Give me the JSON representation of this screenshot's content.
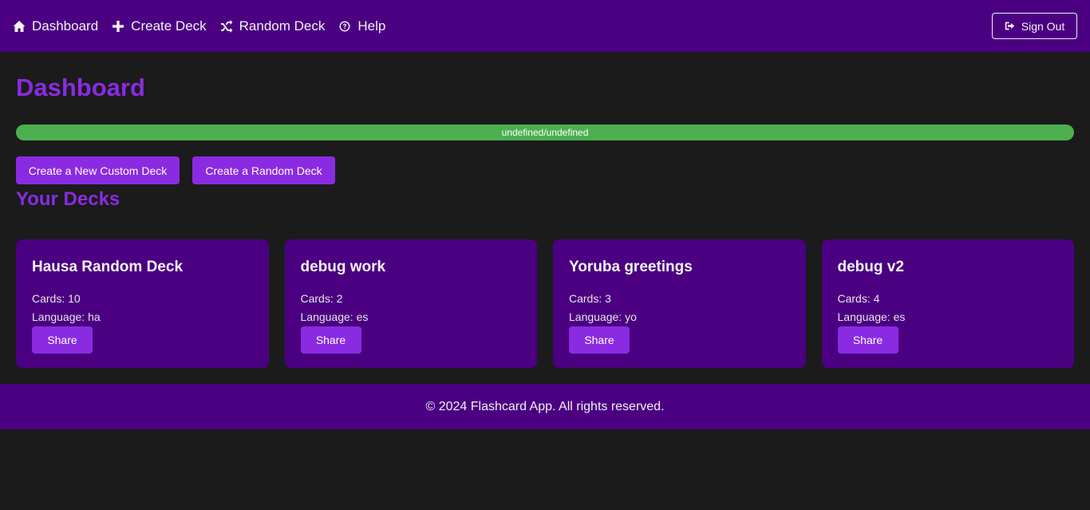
{
  "nav": {
    "items": [
      {
        "label": "Dashboard",
        "icon": "home-icon"
      },
      {
        "label": "Create Deck",
        "icon": "plus-icon"
      },
      {
        "label": "Random Deck",
        "icon": "shuffle-icon"
      },
      {
        "label": "Help",
        "icon": "help-icon"
      }
    ],
    "sign_out": "Sign Out"
  },
  "main": {
    "title": "Dashboard",
    "progress_label": "undefined/undefined",
    "create_custom_label": "Create a New Custom Deck",
    "create_random_label": "Create a Random Deck",
    "decks_title": "Your Decks"
  },
  "decks": [
    {
      "name": "Hausa Random Deck",
      "cards": "Cards: 10",
      "language": "Language: ha",
      "share": "Share"
    },
    {
      "name": "debug work",
      "cards": "Cards: 2",
      "language": "Language: es",
      "share": "Share"
    },
    {
      "name": "Yoruba greetings",
      "cards": "Cards: 3",
      "language": "Language: yo",
      "share": "Share"
    },
    {
      "name": "debug v2",
      "cards": "Cards: 4",
      "language": "Language: es",
      "share": "Share"
    }
  ],
  "footer": {
    "text": "© 2024 Flashcard App. All rights reserved."
  },
  "colors": {
    "header_bg": "#4b0082",
    "accent": "#8a2be2",
    "progress": "#4caf50",
    "page_bg": "#1b1b1b"
  }
}
